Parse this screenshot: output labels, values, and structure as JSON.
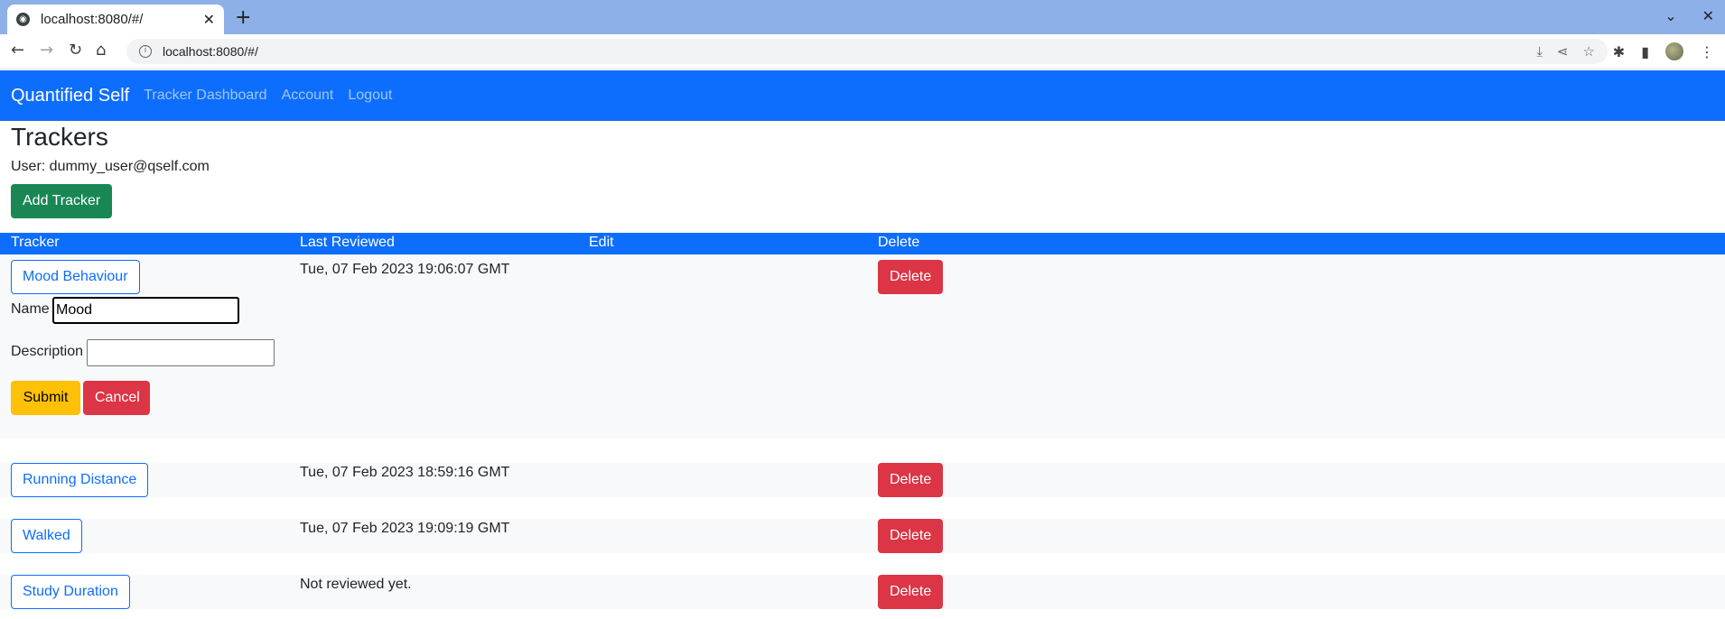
{
  "browser": {
    "tab_title": "localhost:8080/#/",
    "url": "localhost:8080/#/"
  },
  "navbar": {
    "brand": "Quantified Self",
    "links": [
      "Tracker Dashboard",
      "Account",
      "Logout"
    ]
  },
  "page": {
    "title": "Trackers",
    "user_line": "User: dummy_user@qself.com",
    "add_button": "Add Tracker"
  },
  "table": {
    "headers": [
      "Tracker",
      "Last Reviewed",
      "Edit",
      "Delete"
    ],
    "rows": [
      {
        "name": "Mood Behaviour",
        "last_reviewed": "Tue, 07 Feb 2023 19:06:07 GMT",
        "delete": "Delete"
      },
      {
        "name": "Running Distance",
        "last_reviewed": "Tue, 07 Feb 2023 18:59:16 GMT",
        "delete": "Delete"
      },
      {
        "name": "Walked",
        "last_reviewed": "Tue, 07 Feb 2023 19:09:19 GMT",
        "delete": "Delete"
      },
      {
        "name": "Study Duration",
        "last_reviewed": "Not reviewed yet.",
        "delete": "Delete"
      }
    ]
  },
  "edit_form": {
    "name_label": "Name",
    "name_value": "Mood",
    "description_label": "Description",
    "description_value": "",
    "submit": "Submit",
    "cancel": "Cancel"
  }
}
